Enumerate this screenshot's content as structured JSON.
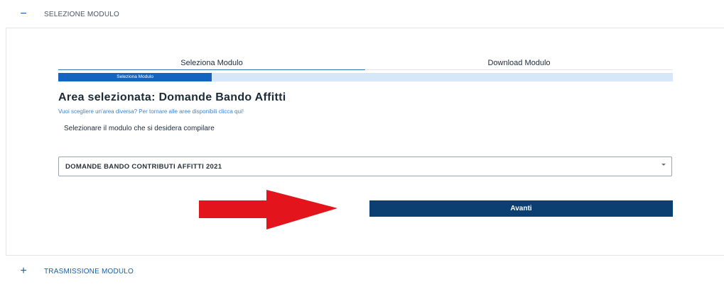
{
  "accordion": {
    "section1": {
      "toggle": "−",
      "label": "SELEZIONE MODULO"
    },
    "section2": {
      "toggle": "+",
      "label": "TRASMISSIONE MODULO"
    }
  },
  "stepper": {
    "steps": [
      "Seleziona Modulo",
      "Download Modulo"
    ],
    "progress_label": "Seleziona Modulo",
    "progress_fraction": 0.25
  },
  "area": {
    "title": "Area selezionata: Domande Bando Affitti",
    "change_link": "Vuoi scegliere un'area diversa? Per tornare alle aree disponibili clicca qui!"
  },
  "form": {
    "instruction": "Selezionare il modulo che si desidera compilare",
    "select_value": "DOMANDE BANDO CONTRIBUTI AFFITTI 2021",
    "next_button": "Avanti"
  },
  "colors": {
    "primary": "#0b3f71",
    "accent": "#1565c0",
    "progress_bg": "#d6e7f7",
    "arrow": "#e3141b"
  }
}
